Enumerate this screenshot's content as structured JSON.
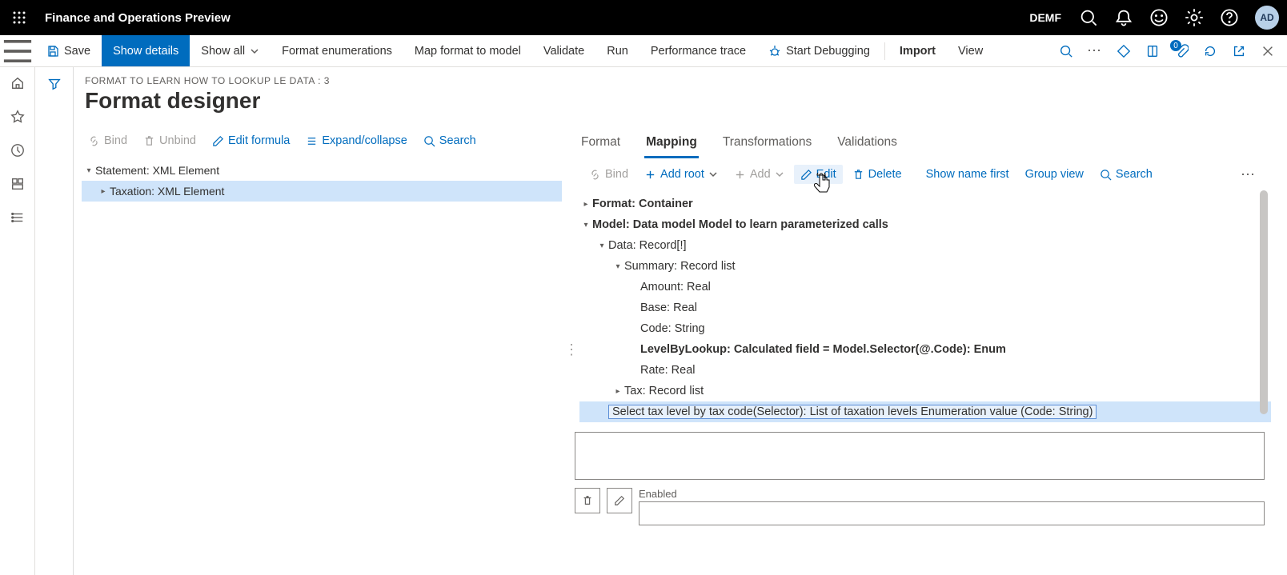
{
  "colors": {
    "accent": "#006cbe"
  },
  "topbar": {
    "app_title": "Finance and Operations Preview",
    "company": "DEMF",
    "avatar": "AD"
  },
  "commandbar": {
    "save": "Save",
    "show_details": "Show details",
    "show_all": "Show all",
    "format_enum": "Format enumerations",
    "map_format": "Map format to model",
    "validate": "Validate",
    "run": "Run",
    "perf_trace": "Performance trace",
    "start_debug": "Start Debugging",
    "import": "Import",
    "view": "View",
    "badge_count": "0"
  },
  "page": {
    "crumb": "FORMAT TO LEARN HOW TO LOOKUP LE DATA : 3",
    "title": "Format designer"
  },
  "left_tools": {
    "bind": "Bind",
    "unbind": "Unbind",
    "edit_formula": "Edit formula",
    "expand": "Expand/collapse",
    "search": "Search"
  },
  "left_tree": [
    {
      "label": "Statement: XML Element",
      "level": 0,
      "caret": "▾",
      "selected": false
    },
    {
      "label": "Taxation: XML Element",
      "level": 1,
      "caret": "▸",
      "selected": true
    }
  ],
  "right_tabs": {
    "format": "Format",
    "mapping": "Mapping",
    "transformations": "Transformations",
    "validations": "Validations",
    "active": "mapping"
  },
  "right_tools": {
    "bind": "Bind",
    "add_root": "Add root",
    "add": "Add",
    "edit": "Edit",
    "delete": "Delete",
    "show_name": "Show name first",
    "group_view": "Group view",
    "search": "Search"
  },
  "right_tree": [
    {
      "label": "Format: Container",
      "level": 0,
      "caret": "▸",
      "bold": true
    },
    {
      "label": "Model: Data model Model to learn parameterized calls",
      "level": 0,
      "caret": "▾",
      "bold": true
    },
    {
      "label": "Data: Record[!]",
      "level": 1,
      "caret": "▾"
    },
    {
      "label": "Summary: Record list",
      "level": 2,
      "caret": "▾"
    },
    {
      "label": "Amount: Real",
      "level": 3,
      "caret": ""
    },
    {
      "label": "Base: Real",
      "level": 3,
      "caret": ""
    },
    {
      "label": "Code: String",
      "level": 3,
      "caret": ""
    },
    {
      "label": "LevelByLookup: Calculated field = Model.Selector(@.Code): Enum",
      "level": 3,
      "caret": "",
      "bold": true
    },
    {
      "label": "Rate: Real",
      "level": 3,
      "caret": ""
    },
    {
      "label": "Tax: Record list",
      "level": 2,
      "caret": "▸"
    },
    {
      "label": "Select tax level by tax code(Selector): List of taxation levels Enumeration value (Code: String)",
      "level": 1,
      "caret": "",
      "selected": true,
      "boxed": true
    }
  ],
  "enabled": {
    "label": "Enabled"
  }
}
